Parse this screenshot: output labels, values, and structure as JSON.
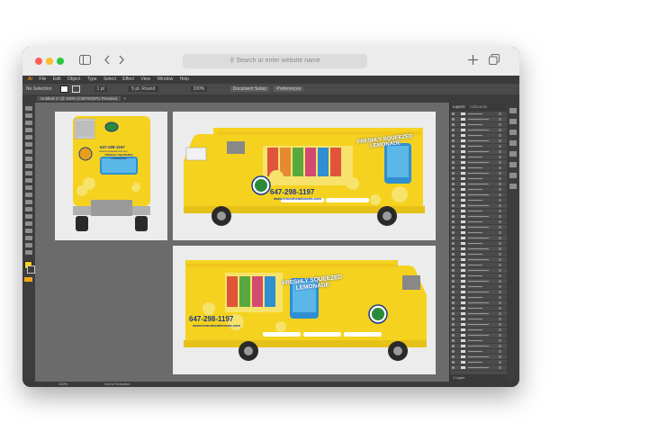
{
  "browser": {
    "address_placeholder": "Search or enter website name",
    "colors": {
      "close": "#fe5f57",
      "minimize": "#febc2e",
      "maximize": "#28c840"
    },
    "icons": [
      "sidebar-icon",
      "back-icon",
      "forward-icon",
      "new-tab-icon",
      "tabs-overview-icon"
    ]
  },
  "app": {
    "menu": [
      "Ai",
      "File",
      "Edit",
      "Object",
      "Type",
      "Select",
      "Effect",
      "View",
      "Window",
      "Help"
    ],
    "control_bar": {
      "selection_label": "No Selection",
      "stroke_weight": "1 pt",
      "stroke_style": "5 pt. Round",
      "opacity": "100%",
      "document_setup_button": "Document Setup",
      "preferences_button": "Preferences"
    },
    "document_tab": "Untitled-1* @ 100% (CMYK/GPU Preview)",
    "panel": {
      "tabs": [
        "Layers",
        "Artboards"
      ],
      "footer": "1 Layer"
    },
    "status": {
      "zoom": "100%",
      "tool": "Direct Selection"
    }
  },
  "artwork": {
    "phone": "647-298-1197",
    "website": "www.lemonheadsnorts.com",
    "slogan_line1": "FRESHLY SQUEEZED",
    "slogan_line2": "LEMONADE",
    "logo_text": "LEMONHEADS",
    "accent": "#f5d21f",
    "brand_blue": "#1a3a8a"
  }
}
